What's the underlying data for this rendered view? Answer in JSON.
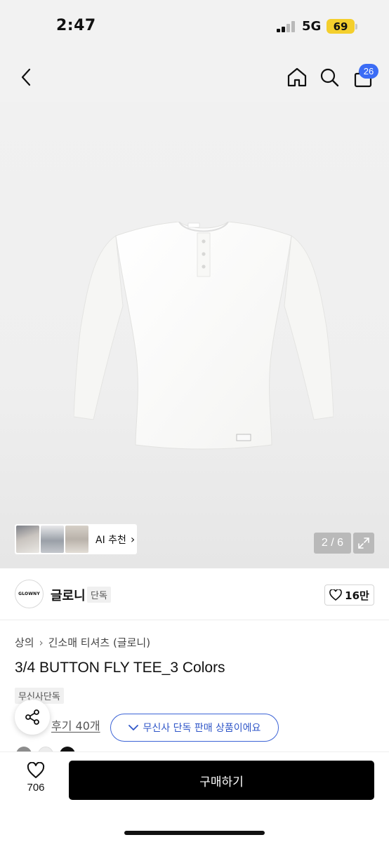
{
  "status_bar": {
    "time": "2:47",
    "network": "5G",
    "battery": "69"
  },
  "nav": {
    "cart_count": "26",
    "icons": [
      "chevron-left-icon",
      "home-icon",
      "search-icon",
      "shopping-bag-icon"
    ]
  },
  "gallery": {
    "ai_label": "AI 추천",
    "pager": "2 / 6",
    "shirt_brand_label": "GLOWNY"
  },
  "brand": {
    "logo_text": "GLOWNY",
    "name": "글로니",
    "tag": "단독",
    "likes": "16만"
  },
  "product": {
    "breadcrumb": [
      "상의",
      "긴소매 티셔츠 (글로니)"
    ],
    "title": "3/4 BUTTON FLY TEE_3 Colors",
    "exclusive_tag": "무신사단독",
    "review_link": "후기 40개",
    "exclusive_notice": "무신사 단독 판매 상품이에요",
    "swatch_colors": [
      "#8c8c8c",
      "#ececec",
      "#111111"
    ]
  },
  "bottom_bar": {
    "wish_count": "706",
    "buy_label": "구매하기"
  },
  "colors": {
    "accent_blue": "#3b6cf5",
    "notice_blue": "#2f56c8",
    "battery_yellow": "#f4cf2d",
    "buy_button": "#000000"
  }
}
